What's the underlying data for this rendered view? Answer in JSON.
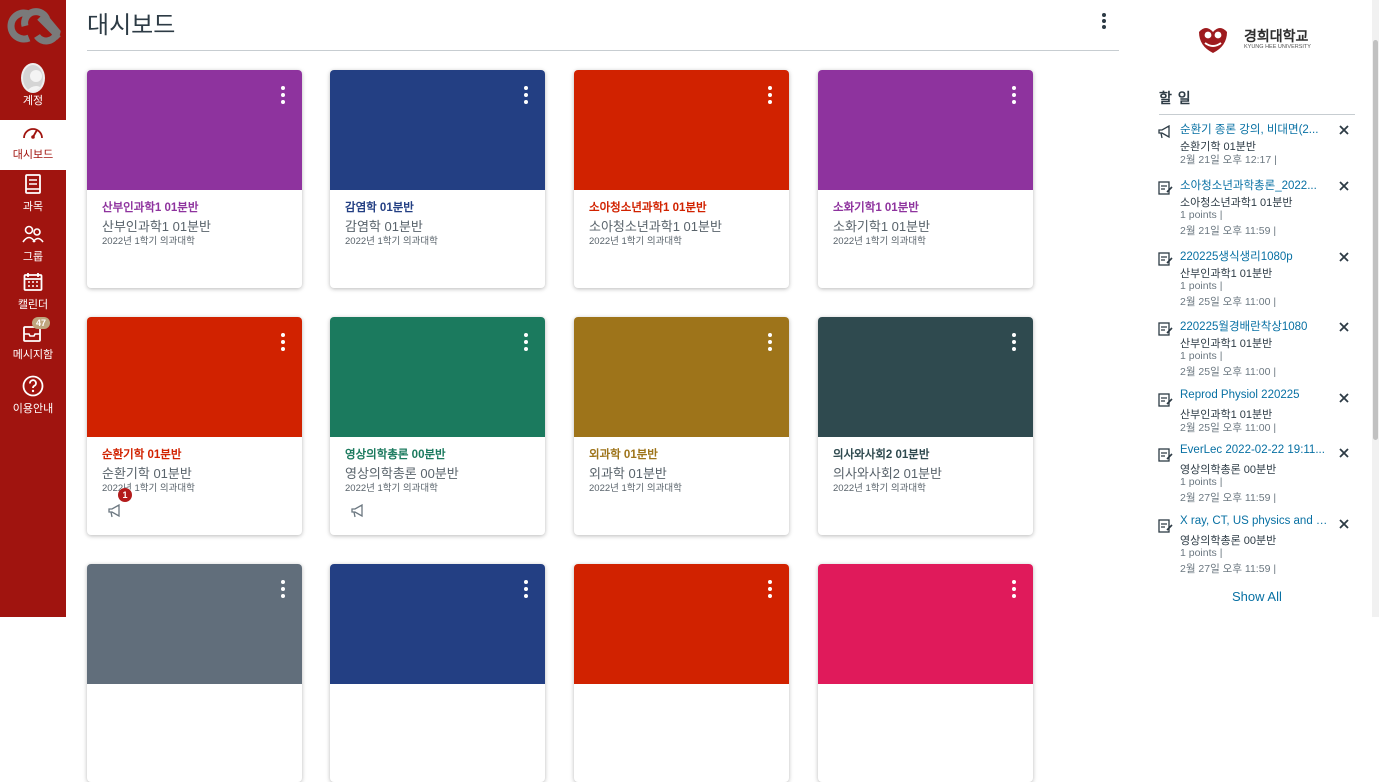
{
  "nav": {
    "items": [
      {
        "label": "계정",
        "icon": "account-avatar-icon"
      },
      {
        "label": "대시보드",
        "icon": "dashboard-gauge-icon",
        "active": true
      },
      {
        "label": "과목",
        "icon": "courses-book-icon"
      },
      {
        "label": "그룹",
        "icon": "groups-people-icon"
      },
      {
        "label": "캘린더",
        "icon": "calendar-icon"
      },
      {
        "label": "메시지함",
        "icon": "inbox-icon",
        "badge": "47"
      },
      {
        "label": "이용안내",
        "icon": "help-question-icon"
      }
    ],
    "color": "#a0140f"
  },
  "header": {
    "title": "대시보드"
  },
  "sidebar": {
    "logo_text": "경희대학교",
    "logo_subtext": "KYUNG HEE UNIVERSITY",
    "todo_title": "할 일",
    "show_all": "Show All",
    "todos": [
      {
        "icon": "announcement-icon",
        "title": "순환기 종론 강의, 비대면(2...",
        "course": "순환기학 01분반",
        "points": "",
        "date": "2월 21일 오후 12:17  |"
      },
      {
        "icon": "assignment-icon",
        "title": "소아청소년과학총론_2022...",
        "course": "소아청소년과학1 01분반",
        "points": "1 points  |",
        "date": "2월 21일 오후 11:59  |"
      },
      {
        "icon": "assignment-icon",
        "title": "220225생식생리1080p",
        "course": "산부인과학1 01분반",
        "points": "1 points  |",
        "date": "2월 25일 오후 11:00  |"
      },
      {
        "icon": "assignment-icon",
        "title": "220225월경배란착상1080",
        "course": "산부인과학1 01분반",
        "points": "1 points  |",
        "date": "2월 25일 오후 11:00  |"
      },
      {
        "icon": "assignment-icon",
        "title": "Reprod Physiol 220225",
        "course": "산부인과학1 01분반",
        "points": "",
        "date": "2월 25일 오후 11:00  |"
      },
      {
        "icon": "assignment-icon",
        "title": "EverLec 2022-02-22 19:11...",
        "course": "영상의학총론 00분반",
        "points": "1 points  |",
        "date": "2월 27일 오후 11:59  |"
      },
      {
        "icon": "assignment-icon",
        "title": "X ray, CT, US physics and a...",
        "course": "영상의학총론 00분반",
        "points": "1 points  |",
        "date": "2월 27일 오후 11:59  |"
      }
    ]
  },
  "cards": [
    {
      "short": "산부인과학1 01분반",
      "name": "산부인과학1 01분반",
      "term": "2022년 1학기 의과대학",
      "color": "#8e339e"
    },
    {
      "short": "감염학 01분반",
      "name": "감염학 01분반",
      "term": "2022년 1학기 의과대학",
      "color": "#233f83"
    },
    {
      "short": "소아청소년과학1 01분반",
      "name": "소아청소년과학1 01분반",
      "term": "2022년 1학기 의과대학",
      "color": "#d12200"
    },
    {
      "short": "소화기학1 01분반",
      "name": "소화기학1 01분반",
      "term": "2022년 1학기 의과대학",
      "color": "#8e339e"
    },
    {
      "short": "순환기학 01분반",
      "name": "순환기학 01분반",
      "term": "2022년 1학기 의과대학",
      "color": "#d12200",
      "announcements": "1"
    },
    {
      "short": "영상의학총론 00분반",
      "name": "영상의학총론 00분반",
      "term": "2022년 1학기 의과대학",
      "color": "#1b7a5e",
      "announcements": ""
    },
    {
      "short": "외과학 01분반",
      "name": "외과학 01분반",
      "term": "2022년 1학기 의과대학",
      "color": "#9e741a"
    },
    {
      "short": "의사와사회2 01분반",
      "name": "의사와사회2 01분반",
      "term": "2022년 1학기 의과대학",
      "color": "#2f4a4f"
    },
    {
      "short": "",
      "name": "",
      "term": "",
      "color": "#616e7b"
    },
    {
      "short": "",
      "name": "",
      "term": "",
      "color": "#233f83"
    },
    {
      "short": "",
      "name": "",
      "term": "",
      "color": "#d12200"
    },
    {
      "short": "",
      "name": "",
      "term": "",
      "color": "#e01a5b"
    }
  ]
}
